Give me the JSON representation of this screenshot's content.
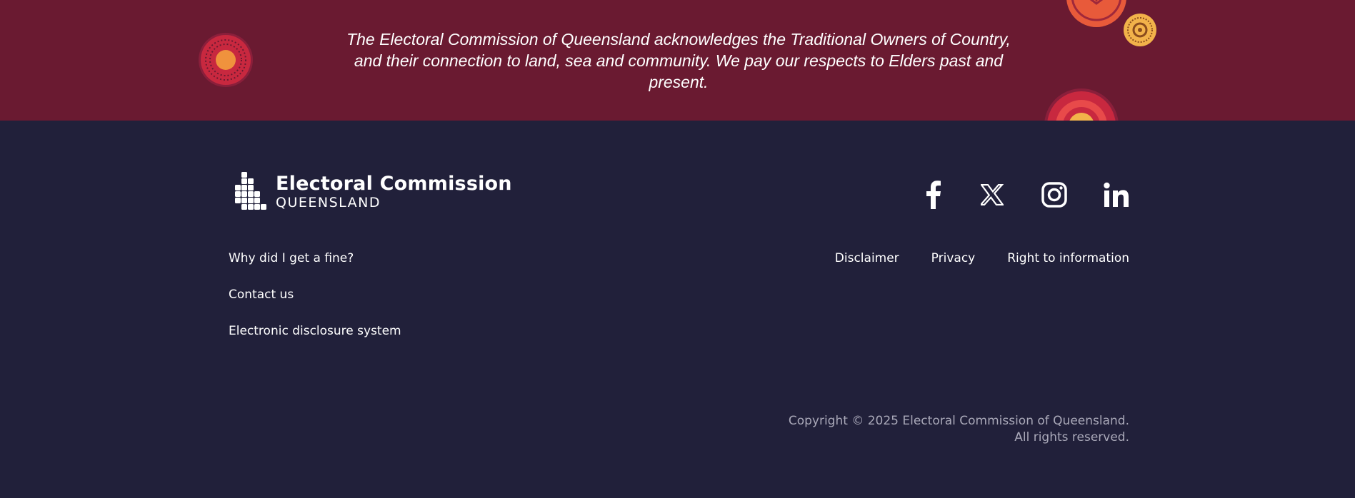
{
  "acknowledgement": {
    "text": "The Electoral Commission of Queensland acknowledges the Traditional Owners of Country, and their connection to land, sea and community. We pay our respects to Elders past and present."
  },
  "logo": {
    "title": "Electoral Commission",
    "subtitle": "QUEENSLAND"
  },
  "social": [
    {
      "name": "facebook-icon"
    },
    {
      "name": "x-icon"
    },
    {
      "name": "instagram-icon"
    },
    {
      "name": "linkedin-icon"
    }
  ],
  "links_left": [
    {
      "label": "Why did I get a fine?"
    },
    {
      "label": "Contact us"
    },
    {
      "label": "Electronic disclosure system"
    }
  ],
  "links_right": [
    {
      "label": "Disclaimer"
    },
    {
      "label": "Privacy"
    },
    {
      "label": "Right to information"
    }
  ],
  "copyright": {
    "line1": "Copyright © 2025 Electoral Commission of Queensland.",
    "line2": "All rights reserved."
  },
  "colors": {
    "band": "#6a1a31",
    "footer": "#21203a",
    "art_red": "#c8283f",
    "art_orange": "#f0923d",
    "art_yellow": "#f2b24a"
  }
}
